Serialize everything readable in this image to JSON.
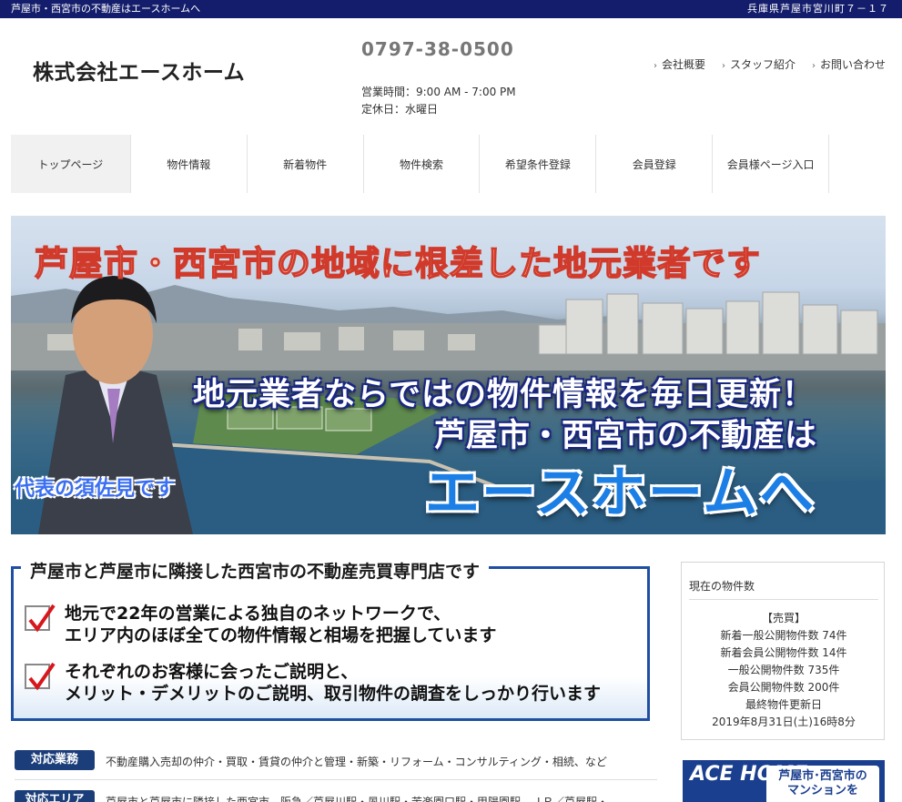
{
  "topbar": {
    "tagline": "芦屋市・西宮市の不動産はエースホームへ",
    "address": "兵庫県芦屋市宮川町７－１７"
  },
  "header": {
    "logo": "株式会社エースホーム",
    "phone": "0797-38-0500",
    "hours": "営業時間：9:00 AM - 7:00 PM",
    "closed": "定休日：水曜日",
    "links": [
      "会社概要",
      "スタッフ紹介",
      "お問い合わせ"
    ]
  },
  "nav": {
    "items": [
      "トップページ",
      "物件情報",
      "新着物件",
      "物件検索",
      "希望条件登録",
      "会員登録",
      "会員様ページ入口"
    ],
    "active_index": 0
  },
  "hero": {
    "headline": "芦屋市・西宮市の地域に根差した地元業者です",
    "line2": "地元業者ならではの物件情報を毎日更新！",
    "line3": "芦屋市・西宮市の不動産は",
    "line4": "エースホームへ",
    "caption": "代表の須佐見です"
  },
  "banner": {
    "title": "芦屋市と芦屋市に隣接した西宮市の不動産売買専門店です",
    "points": [
      [
        "地元で22年の営業による独自のネットワークで、",
        "エリア内のほぼ全ての物件情報と相場を把握しています"
      ],
      [
        "それぞれのお客様に会ったご説明と、",
        "メリット・デメリットのご説明、取引物件の調査をしっかり行います"
      ]
    ]
  },
  "sidebar": {
    "title": "現在の物件数",
    "rows": [
      "【売買】",
      "新着一般公開物件数 74件",
      "新着会員公開物件数 14件",
      "一般公開物件数 735件",
      "会員公開物件数 200件",
      "最終物件更新日",
      "2019年8月31日(土)16時8分"
    ]
  },
  "ace_banner": {
    "logo": "ACE HOME",
    "text1": "芦屋市･西宮市の",
    "text2": "マンションを"
  },
  "business": [
    {
      "tag": "対応業務",
      "text": "不動産購入売却の仲介・買取・賃貸の仲介と管理・新築・リフォーム・コンサルティング・相続、など"
    },
    {
      "tag": "対応エリア",
      "text": "芦屋市と芦屋市に隣接した西宮市、阪急／芦屋川駅・夙川駅・苦楽園口駅・甲陽園駅、ＪＲ／芦屋駅・"
    }
  ],
  "colors": {
    "topbar": "#141d6b",
    "banner_border": "#1f4ea3",
    "tag_bg": "#1b3e7a",
    "hero_accent": "#1c7fe6"
  }
}
